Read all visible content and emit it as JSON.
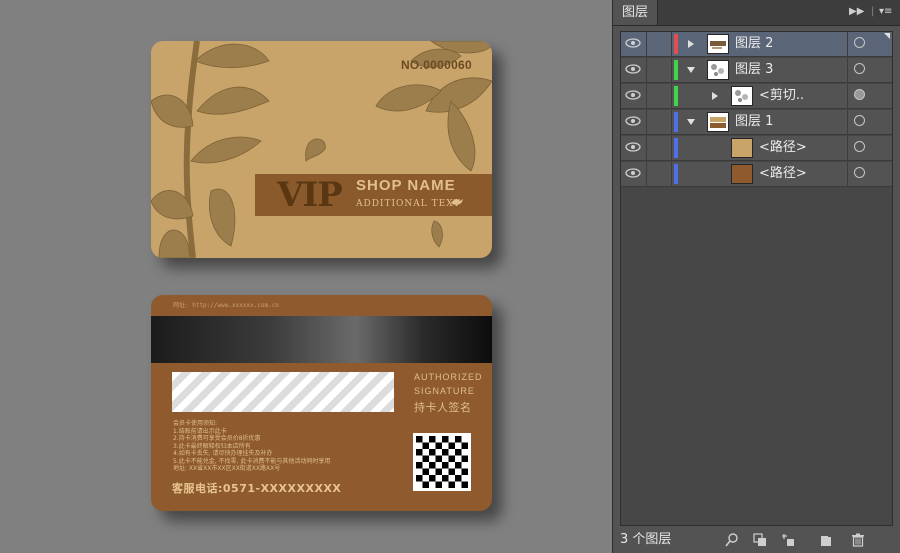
{
  "card_front": {
    "number": "NO.0000060",
    "vip": "VIP",
    "shop_name": "SHOP NAME",
    "additional_text": "ADDITIONAL TEXT"
  },
  "card_back": {
    "website": "网址: http://www.xxxxxx.com.cn",
    "signature_label_en_1": "AUTHORIZED",
    "signature_label_en_2": "SIGNATURE",
    "signature_label_cn": "持卡人签名",
    "notes": [
      "会员卡使用须知:",
      "1.结账前请出示此卡",
      "2.持卡消费可享受会员价8折优惠",
      "3.此卡最终解释权归本店所有",
      "4.如有卡丢失, 请尽快办理挂失及补办",
      "5.此卡不能兑金, 不找零, 此卡消费不能与其他活动同时享用",
      "地址: XX省XX市XX区XX街道XX路XX号"
    ],
    "hotline": "客服电话:0571-XXXXXXXXX"
  },
  "layers_panel": {
    "tab_title": "图层",
    "layers": [
      {
        "name": "图层 2",
        "color": "#e05050",
        "expanded": false,
        "selected": true,
        "indent": 0,
        "has_toggle": true
      },
      {
        "name": "图层 3",
        "color": "#3fd44a",
        "expanded": true,
        "selected": false,
        "indent": 0,
        "has_toggle": true
      },
      {
        "name": "<剪切..",
        "color": "#3fd44a",
        "expanded": false,
        "selected": false,
        "indent": 1,
        "has_toggle": true
      },
      {
        "name": "图层 1",
        "color": "#4f6fe6",
        "expanded": true,
        "selected": false,
        "indent": 0,
        "has_toggle": true
      },
      {
        "name": "<路径>",
        "color": "#4f6fe6",
        "expanded": false,
        "selected": false,
        "indent": 2,
        "has_toggle": false
      },
      {
        "name": "<路径>",
        "color": "#4f6fe6",
        "expanded": false,
        "selected": false,
        "indent": 2,
        "has_toggle": false
      }
    ],
    "footer_count": "3 个图层"
  },
  "colors": {
    "card_front_bg": "#c8a46a",
    "card_back_bg": "#8e5a2e",
    "vip_band": "#8a5a2c",
    "accent_text": "#e2c08d"
  }
}
